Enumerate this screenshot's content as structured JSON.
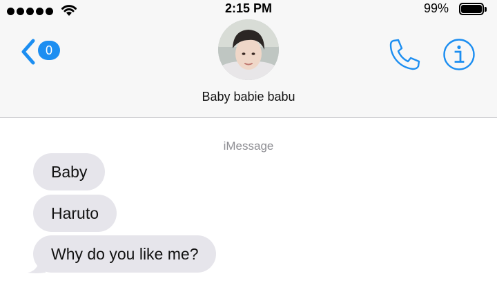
{
  "status_bar": {
    "time": "2:15 PM",
    "battery": "99%"
  },
  "nav": {
    "back_badge": "0",
    "contact_name": "Baby babie babu"
  },
  "conversation": {
    "service_label": "iMessage",
    "messages": [
      {
        "text": "Baby",
        "direction": "incoming"
      },
      {
        "text": "Haruto",
        "direction": "incoming"
      },
      {
        "text": "Why do you like me?",
        "direction": "incoming"
      }
    ]
  },
  "colors": {
    "accent": "#1c8ef1",
    "incoming_bubble": "#e6e5eb",
    "header_bg": "#f7f7f7",
    "secondary_text": "#8e8e93"
  },
  "icons": {
    "back": "chevron-left-icon",
    "call": "phone-icon",
    "info": "info-icon",
    "wifi": "wifi-icon",
    "battery": "battery-icon"
  }
}
